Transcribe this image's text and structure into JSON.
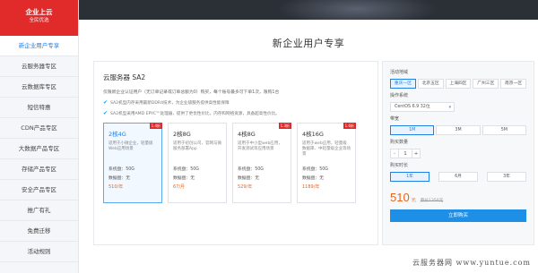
{
  "sidebar": {
    "header_title": "企业上云",
    "header_subtitle": "全民优选",
    "items": [
      {
        "label": "新企业用户专享",
        "active": true
      },
      {
        "label": "云服务器专区",
        "active": false
      },
      {
        "label": "云数据库专区",
        "active": false
      },
      {
        "label": "短信特惠",
        "active": false
      },
      {
        "label": "CDN产品专区",
        "active": false
      },
      {
        "label": "大数据产品专区",
        "active": false
      },
      {
        "label": "存储产品专区",
        "active": false
      },
      {
        "label": "安全产品专区",
        "active": false
      },
      {
        "label": "推广有礼",
        "active": false
      },
      {
        "label": "免费迁移",
        "active": false
      },
      {
        "label": "活动规则",
        "active": false
      }
    ]
  },
  "page_title": "新企业用户专享",
  "product": {
    "name": "云服务器 SA2",
    "description": "仅限新企业认证用户（无订单记录或订单总额为0）购买，每个账号最多可下单1次，限购1台",
    "features": [
      "SA2机型内存采用最新DDR4技术，为企业级服务提供高性能保障",
      "SA2机型采用AMD EPYC™处理器，提供了更优性价比，内存和网络资源，具备超高性价比。"
    ],
    "plans": [
      {
        "spec": "2核4G",
        "badge": "1.4折",
        "use": "适用于小微企业，轻量级Web应用场景",
        "system_disk": "系统盘：50G",
        "data_disk": "数据盘：无",
        "price": "510/年",
        "selected": true
      },
      {
        "spec": "2核8G",
        "badge": "",
        "use": "适用于初创公司，官网与微服务部署App",
        "system_disk": "系统盘：50G",
        "data_disk": "数据盘：无",
        "price": "67/月",
        "selected": false
      },
      {
        "spec": "4核8G",
        "badge": "1.3折",
        "use": "适用于中小型web应用，开发测试等应用场景",
        "system_disk": "系统盘：50G",
        "data_disk": "数据盘：无",
        "price": "529/年",
        "selected": false
      },
      {
        "spec": "4核16G",
        "badge": "1.6折",
        "use": "适用于web应用，轻量级数据库、中轻量级企业等场景",
        "system_disk": "系统盘：50G",
        "data_disk": "数据盘：无",
        "price": "1189/年",
        "selected": false
      }
    ]
  },
  "config": {
    "region_label": "活动地域",
    "regions": [
      {
        "label": "重庆一区",
        "selected": true
      },
      {
        "label": "北京五区",
        "selected": false
      },
      {
        "label": "上海四区",
        "selected": false
      },
      {
        "label": "广州三区",
        "selected": false
      },
      {
        "label": "南京一区",
        "selected": false
      }
    ],
    "os_label": "操作系统",
    "os_value": "CentOS 6.9 32位",
    "bandwidth_label": "带宽",
    "bandwidths": [
      {
        "label": "1M",
        "selected": true
      },
      {
        "label": "3M",
        "selected": false
      },
      {
        "label": "5M",
        "selected": false
      }
    ],
    "quantity_label": "购买数量",
    "quantity_minus": "-",
    "quantity_value": "1",
    "quantity_plus": "+",
    "duration_label": "购买时长",
    "durations": [
      {
        "label": "1年",
        "selected": true
      },
      {
        "label": "6月",
        "selected": false
      },
      {
        "label": "3年",
        "selected": false
      }
    ],
    "price": "510",
    "currency": "元",
    "original_price": "原价1350元",
    "buy_label": "立即购买"
  },
  "watermark": "云服务器网 www.yuntue.com",
  "colors": {
    "brand_red": "#e12b2b",
    "accent_blue": "#1e8fe6",
    "price_orange": "#e8641c"
  }
}
